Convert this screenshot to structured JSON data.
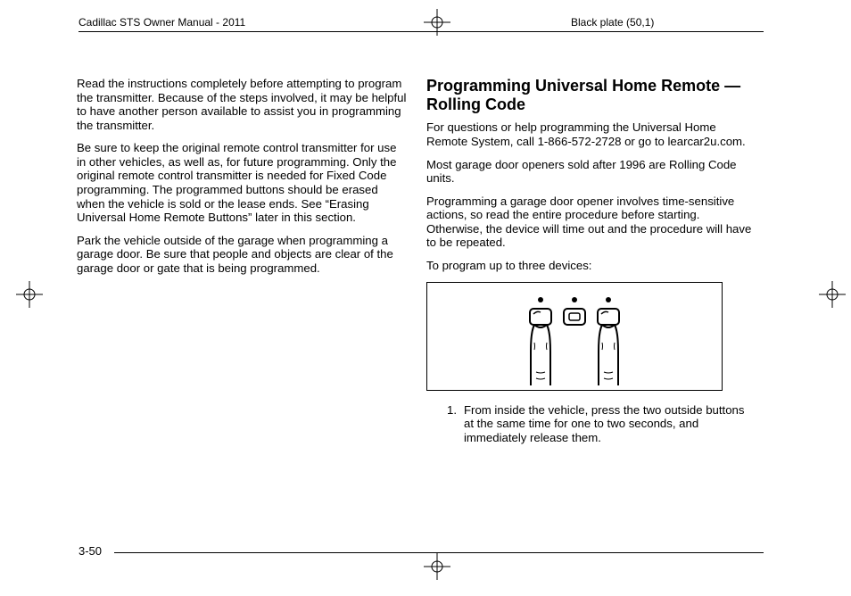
{
  "header": {
    "left": "Cadillac STS Owner Manual - 2011",
    "right": "Black plate (50,1)"
  },
  "page_number": "3-50",
  "left_column": {
    "p1": "Read the instructions completely before attempting to program the transmitter. Because of the steps involved, it may be helpful to have another person available to assist you in programming the transmitter.",
    "p2": "Be sure to keep the original remote control transmitter for use in other vehicles, as well as, for future programming. Only the original remote control transmitter is needed for Fixed Code programming. The programmed buttons should be erased when the vehicle is sold or the lease ends. See “Erasing Universal Home Remote Buttons” later in this section.",
    "p3": "Park the vehicle outside of the garage when programming a garage door. Be sure that people and objects are clear of the garage door or gate that is being programmed."
  },
  "right_column": {
    "heading": "Programming Universal Home Remote — Rolling Code",
    "p1": "For questions or help programming the Universal Home Remote System, call 1-866-572-2728 or go to learcar2u.com.",
    "p2": "Most garage door openers sold after 1996 are Rolling Code units.",
    "p3": "Programming a garage door opener involves time-sensitive actions, so read the entire procedure before starting. Otherwise, the device will time out and the procedure will have to be repeated.",
    "p4": "To program up to three devices:",
    "step1_num": "1.",
    "step1": "From inside the vehicle, press the two outside buttons at the same time for one to two seconds, and immediately release them."
  }
}
